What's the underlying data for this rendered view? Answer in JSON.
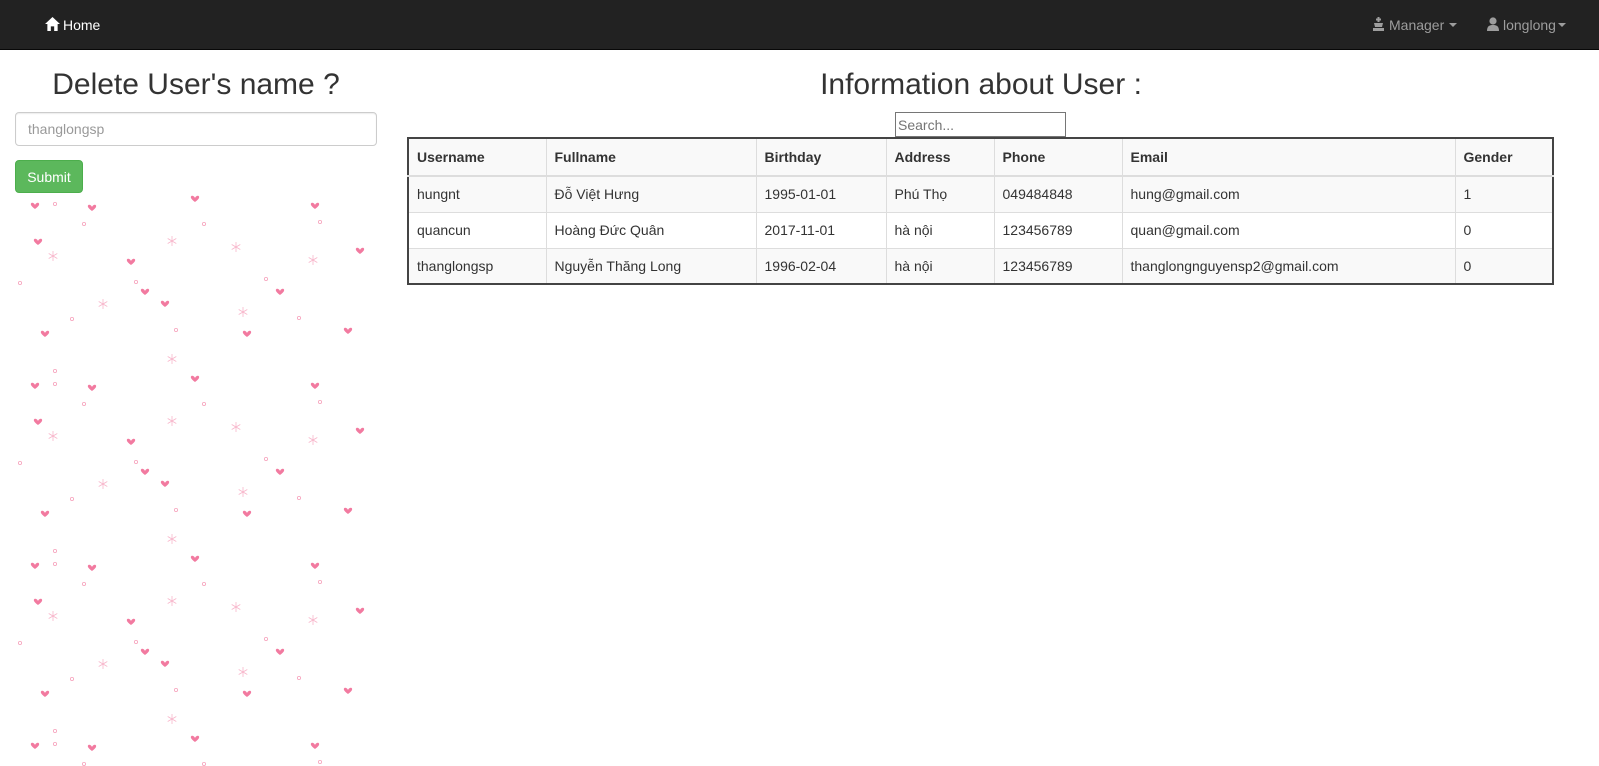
{
  "navbar": {
    "home_label": "Home",
    "manager_label": "Manager",
    "user_label": "longlong"
  },
  "delete_panel": {
    "title": "Delete User's name ?",
    "input_value": "thanglongsp",
    "submit_label": "Submit"
  },
  "info_panel": {
    "title": "Information about User :",
    "search_placeholder": "Search..."
  },
  "table": {
    "headers": [
      "Username",
      "Fullname",
      "Birthday",
      "Address",
      "Phone",
      "Email",
      "Gender"
    ],
    "rows": [
      [
        "hungnt",
        "Đỗ Việt Hưng",
        "1995-01-01",
        "Phú Thọ",
        "049484848",
        "hung@gmail.com",
        "1"
      ],
      [
        "quancun",
        "Hoàng Đức Quân",
        "2017-11-01",
        "hà nội",
        "123456789",
        "quan@gmail.com",
        "0"
      ],
      [
        "thanglongsp",
        "Nguyễn Thăng Long",
        "1996-02-04",
        "hà nội",
        "123456789",
        "thanglongnguyensp2@gmail.com",
        "0"
      ]
    ]
  },
  "colors": {
    "navbar_bg": "#222222",
    "success": "#5cb85c",
    "heart": "#f27aa0"
  },
  "icons": [
    "home-icon",
    "chess-king-icon",
    "user-icon",
    "heart-icon",
    "snowflake-icon"
  ]
}
